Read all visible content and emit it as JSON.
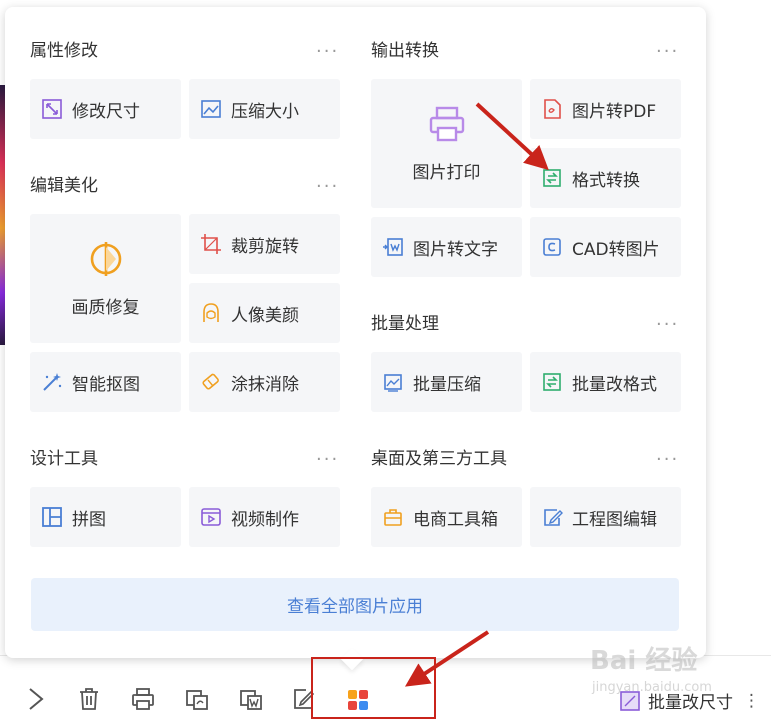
{
  "sections": {
    "attr": {
      "title": "属性修改",
      "more": "···"
    },
    "output": {
      "title": "输出转换",
      "more": "···"
    },
    "edit": {
      "title": "编辑美化",
      "more": "···"
    },
    "batch": {
      "title": "批量处理",
      "more": "···"
    },
    "design": {
      "title": "设计工具",
      "more": "···"
    },
    "desktop": {
      "title": "桌面及第三方工具",
      "more": "···"
    }
  },
  "tiles": {
    "resize": "修改尺寸",
    "compress": "压缩大小",
    "print": "图片打印",
    "to_pdf": "图片转PDF",
    "format": "格式转换",
    "to_text": "图片转文字",
    "cad": "CAD转图片",
    "repair": "画质修复",
    "crop": "裁剪旋转",
    "beauty": "人像美颜",
    "matting": "智能抠图",
    "erase": "涂抹消除",
    "batch_compress": "批量压缩",
    "batch_format": "批量改格式",
    "collage": "拼图",
    "video": "视频制作",
    "ecommerce": "电商工具箱",
    "drawing": "工程图编辑"
  },
  "all_apps_label": "查看全部图片应用",
  "bottom_right": {
    "label": "批量改尺寸",
    "more": "⋮"
  },
  "watermark": {
    "main": "Bai 经验",
    "sub": "jingyan.baidu.com"
  },
  "colors": {
    "accent": "#4a7fd4",
    "annotation": "#c9241b"
  }
}
